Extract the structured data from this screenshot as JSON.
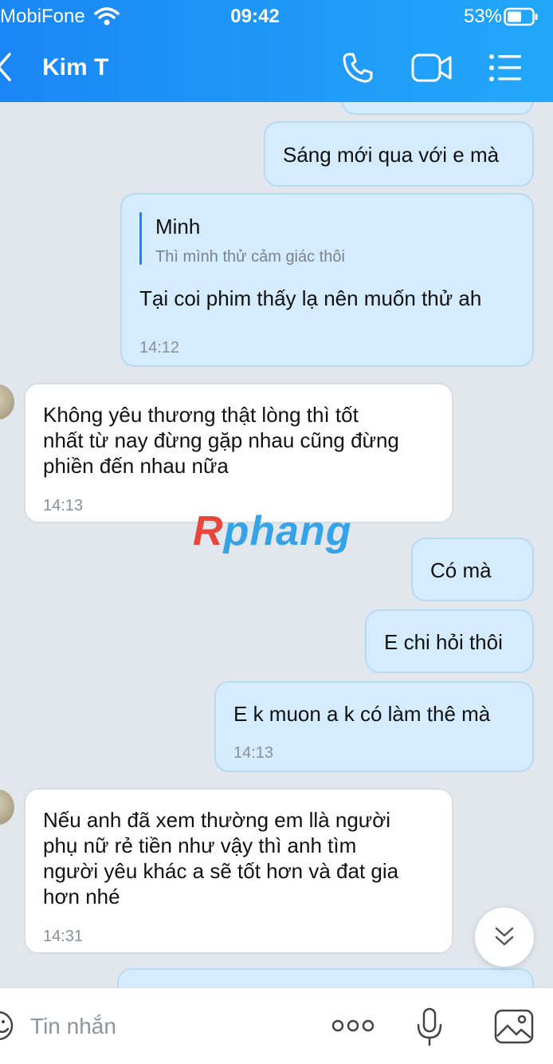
{
  "status_bar": {
    "carrier": "MobiFone",
    "time": "09:42",
    "battery": "53%"
  },
  "header": {
    "contact_name": "Kim T"
  },
  "messages": {
    "m1": {
      "text": "Sáng mới qua với e mà"
    },
    "m2": {
      "quote_author": "Minh",
      "quote_text": "Thì mình thử cảm giác thôi",
      "text": "Tại coi phim thấy lạ nên muốn thử ah",
      "time": "14:12"
    },
    "m3": {
      "line1": "Không yêu thương thật lòng thì tốt",
      "line2": "nhất từ nay đừng gặp nhau cũng đừng",
      "line3": "phiền đến nhau nữa",
      "time": "14:13"
    },
    "m4": {
      "text": "Có mà"
    },
    "m5": {
      "text": "E chi hỏi thôi"
    },
    "m6": {
      "text": "E k muon a k có làm thê mà",
      "time": "14:13"
    },
    "m7": {
      "line1": "Nếu anh đã xem thường em llà người",
      "line2": "phụ nữ  rẻ tiền như vậy thì anh tìm",
      "line3": "người yêu khác a sẽ tốt hơn và đat gia",
      "line4": "hơn nhé",
      "time": "14:31"
    }
  },
  "watermark": {
    "first": "R",
    "rest": "phang"
  },
  "input": {
    "placeholder": "Tin nhắn"
  },
  "colors": {
    "header": "#1a86f5",
    "outgoing_bubble": "#d4ecfd",
    "incoming_bubble": "#ffffff",
    "background": "#e2e7ee"
  }
}
